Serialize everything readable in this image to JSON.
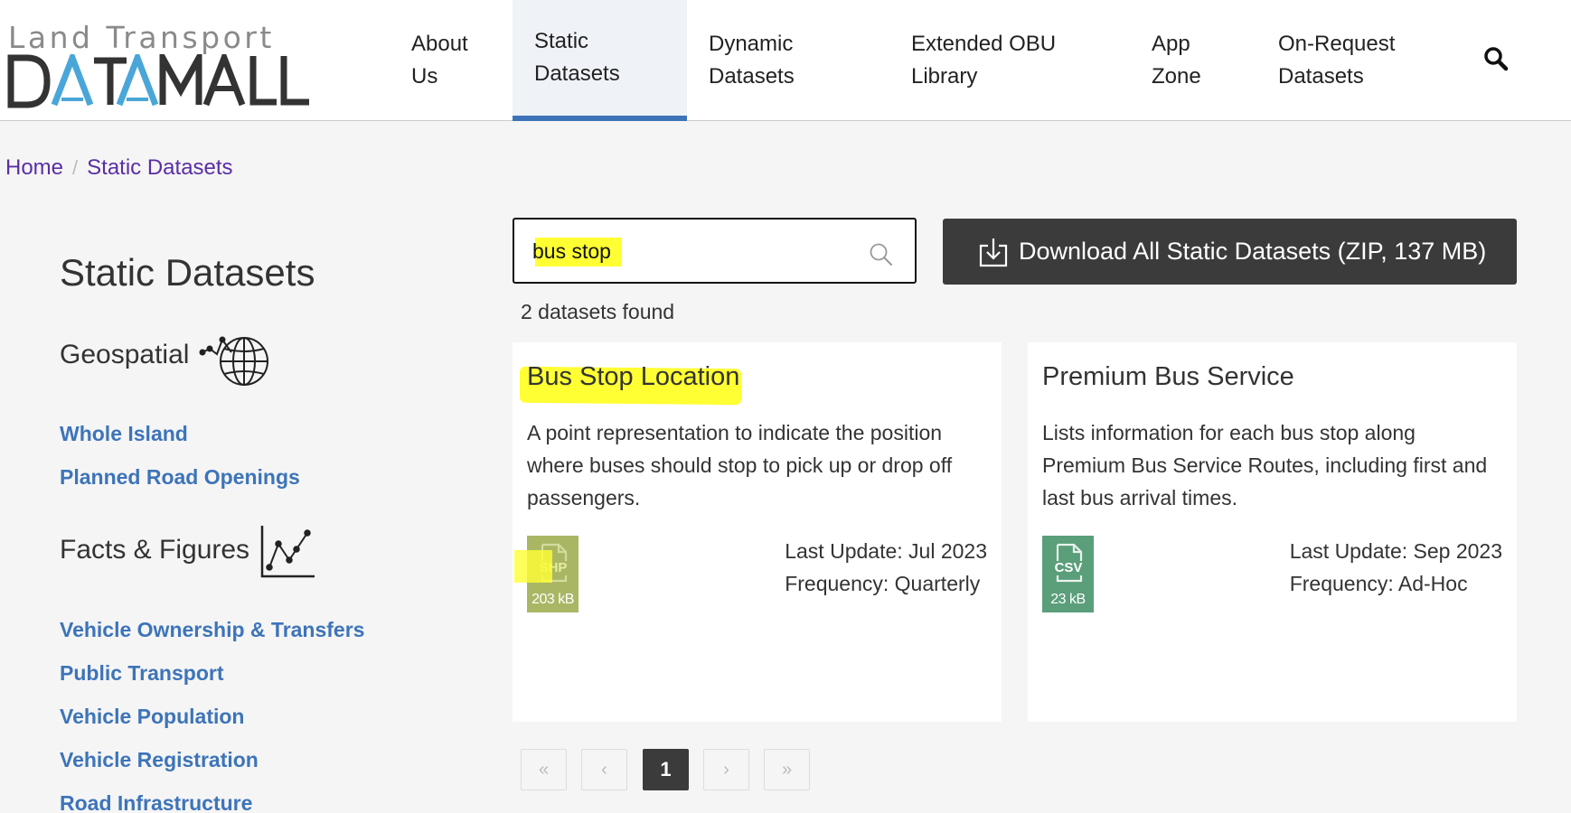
{
  "logo": {
    "tagline": "Land Transport",
    "wordmark": "DATAMALL"
  },
  "nav": {
    "items": [
      {
        "line1": "About",
        "line2": "Us"
      },
      {
        "line1": "Static",
        "line2": "Datasets"
      },
      {
        "line1": "Dynamic",
        "line2": "Datasets"
      },
      {
        "line1": "Extended OBU",
        "line2": "Library"
      },
      {
        "line1": "App",
        "line2": "Zone"
      },
      {
        "line1": "On-Request",
        "line2": "Datasets"
      }
    ],
    "active_index": 1,
    "search_icon": "search-icon"
  },
  "breadcrumb": {
    "home": "Home",
    "separator": "/",
    "current": "Static Datasets"
  },
  "sidebar": {
    "title": "Static Datasets",
    "geospatial": {
      "label": "Geospatial",
      "icon": "globe-icon",
      "links": [
        "Whole Island",
        "Planned Road Openings"
      ]
    },
    "facts": {
      "label": "Facts & Figures",
      "icon": "line-chart-icon",
      "links": [
        "Vehicle Ownership & Transfers",
        "Public Transport",
        "Vehicle Population",
        "Vehicle Registration",
        "Road Infrastructure"
      ]
    }
  },
  "search": {
    "value": "bus stop",
    "icon": "search-icon"
  },
  "download": {
    "label": "Download All Static Datasets (ZIP, 137 MB)",
    "icon": "download-icon"
  },
  "results": {
    "count_text": "2 datasets found",
    "cards": [
      {
        "title": "Bus Stop Location",
        "description": "A point representation to indicate the position where buses should stop to pick up or drop off passengers.",
        "file_type": "SHP",
        "file_size": "203 kB",
        "file_color": "#a9b765",
        "last_update": "Last Update: Jul 2023",
        "frequency": "Frequency: Quarterly"
      },
      {
        "title": "Premium Bus Service",
        "description": "Lists information for each bus stop along Premium Bus Service Routes, including first and last bus arrival times.",
        "file_type": "CSV",
        "file_size": "23 kB",
        "file_color": "#5a9e7a",
        "last_update": "Last Update: Sep 2023",
        "frequency": "Frequency: Ad-Hoc"
      }
    ]
  },
  "pagination": {
    "first": "«",
    "prev": "‹",
    "current": "1",
    "next": "›",
    "last": "»"
  },
  "colors": {
    "link": "#3d74b9",
    "breadcrumb": "#5a2ea6",
    "highlight": "#ffff33",
    "dark_button": "#3b3b3b"
  }
}
